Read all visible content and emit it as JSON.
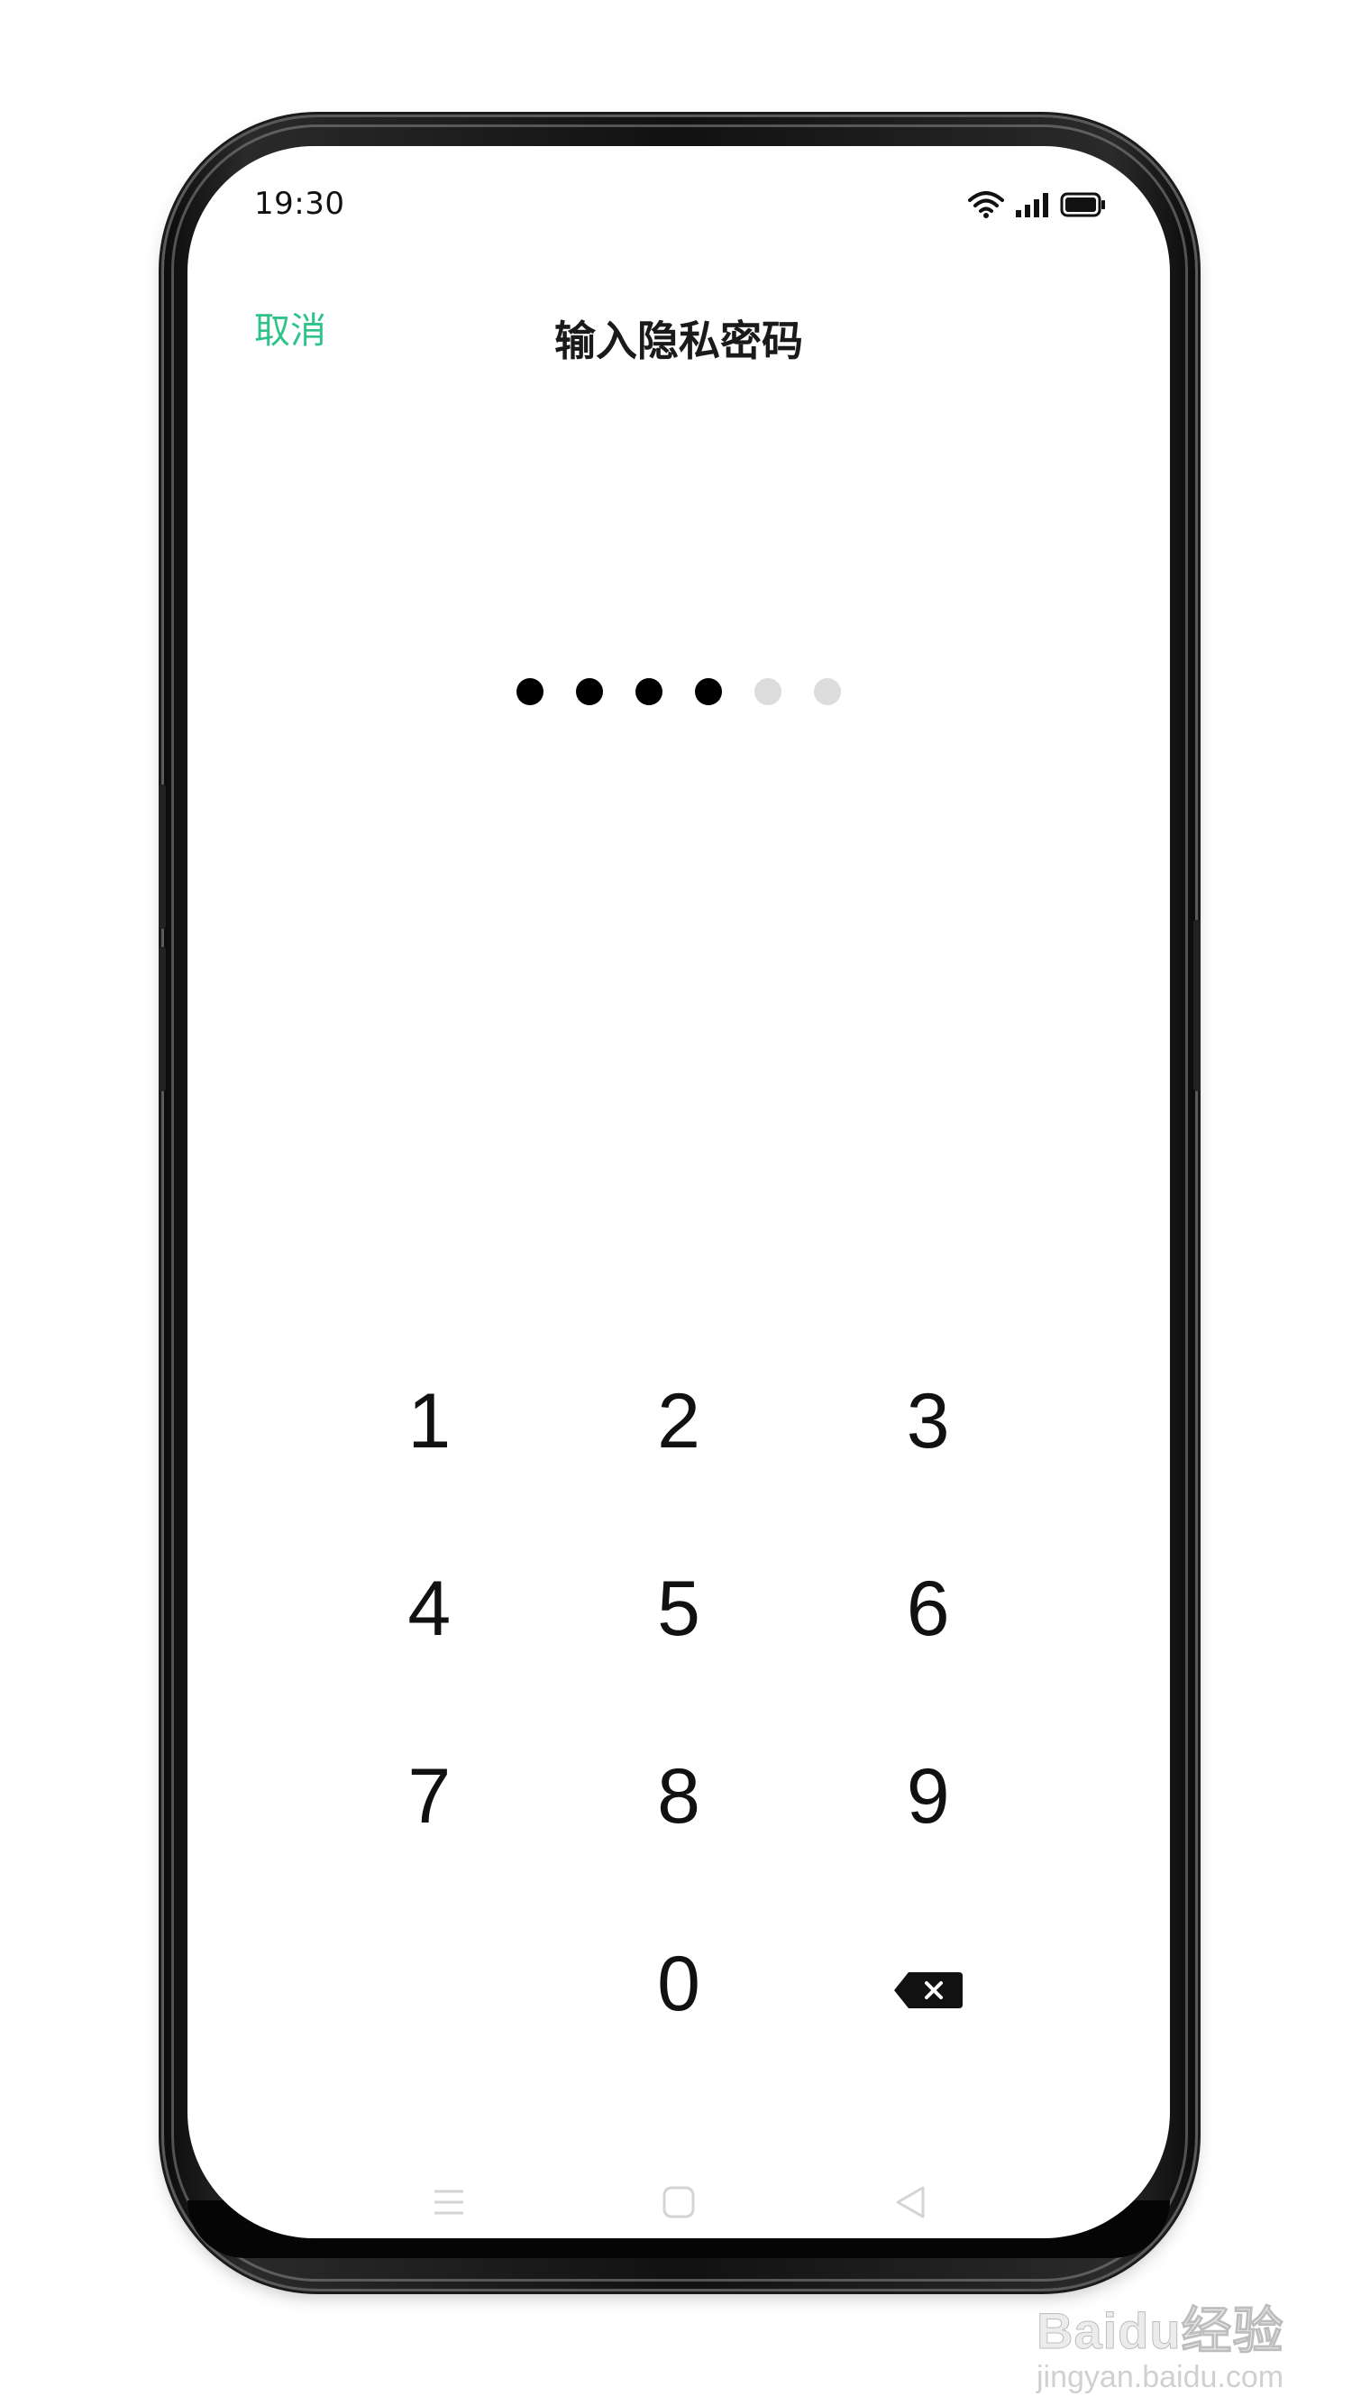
{
  "status_bar": {
    "time": "19:30",
    "icons": [
      "wifi-icon",
      "signal-icon",
      "battery-icon"
    ]
  },
  "header": {
    "cancel_label": "取消",
    "title": "输入隐私密码"
  },
  "pin": {
    "length": 6,
    "filled": 4
  },
  "keypad": {
    "keys": [
      "1",
      "2",
      "3",
      "4",
      "5",
      "6",
      "7",
      "8",
      "9",
      "",
      "0",
      "backspace"
    ]
  },
  "nav_bar": {
    "icons": [
      "menu-icon",
      "home-icon",
      "back-icon"
    ]
  },
  "watermark": {
    "brand": "Baidu经验",
    "url": "jingyan.baidu.com"
  },
  "colors": {
    "accent": "#2fc28a",
    "pin_filled": "#000000",
    "pin_empty": "#dcdcdc"
  }
}
